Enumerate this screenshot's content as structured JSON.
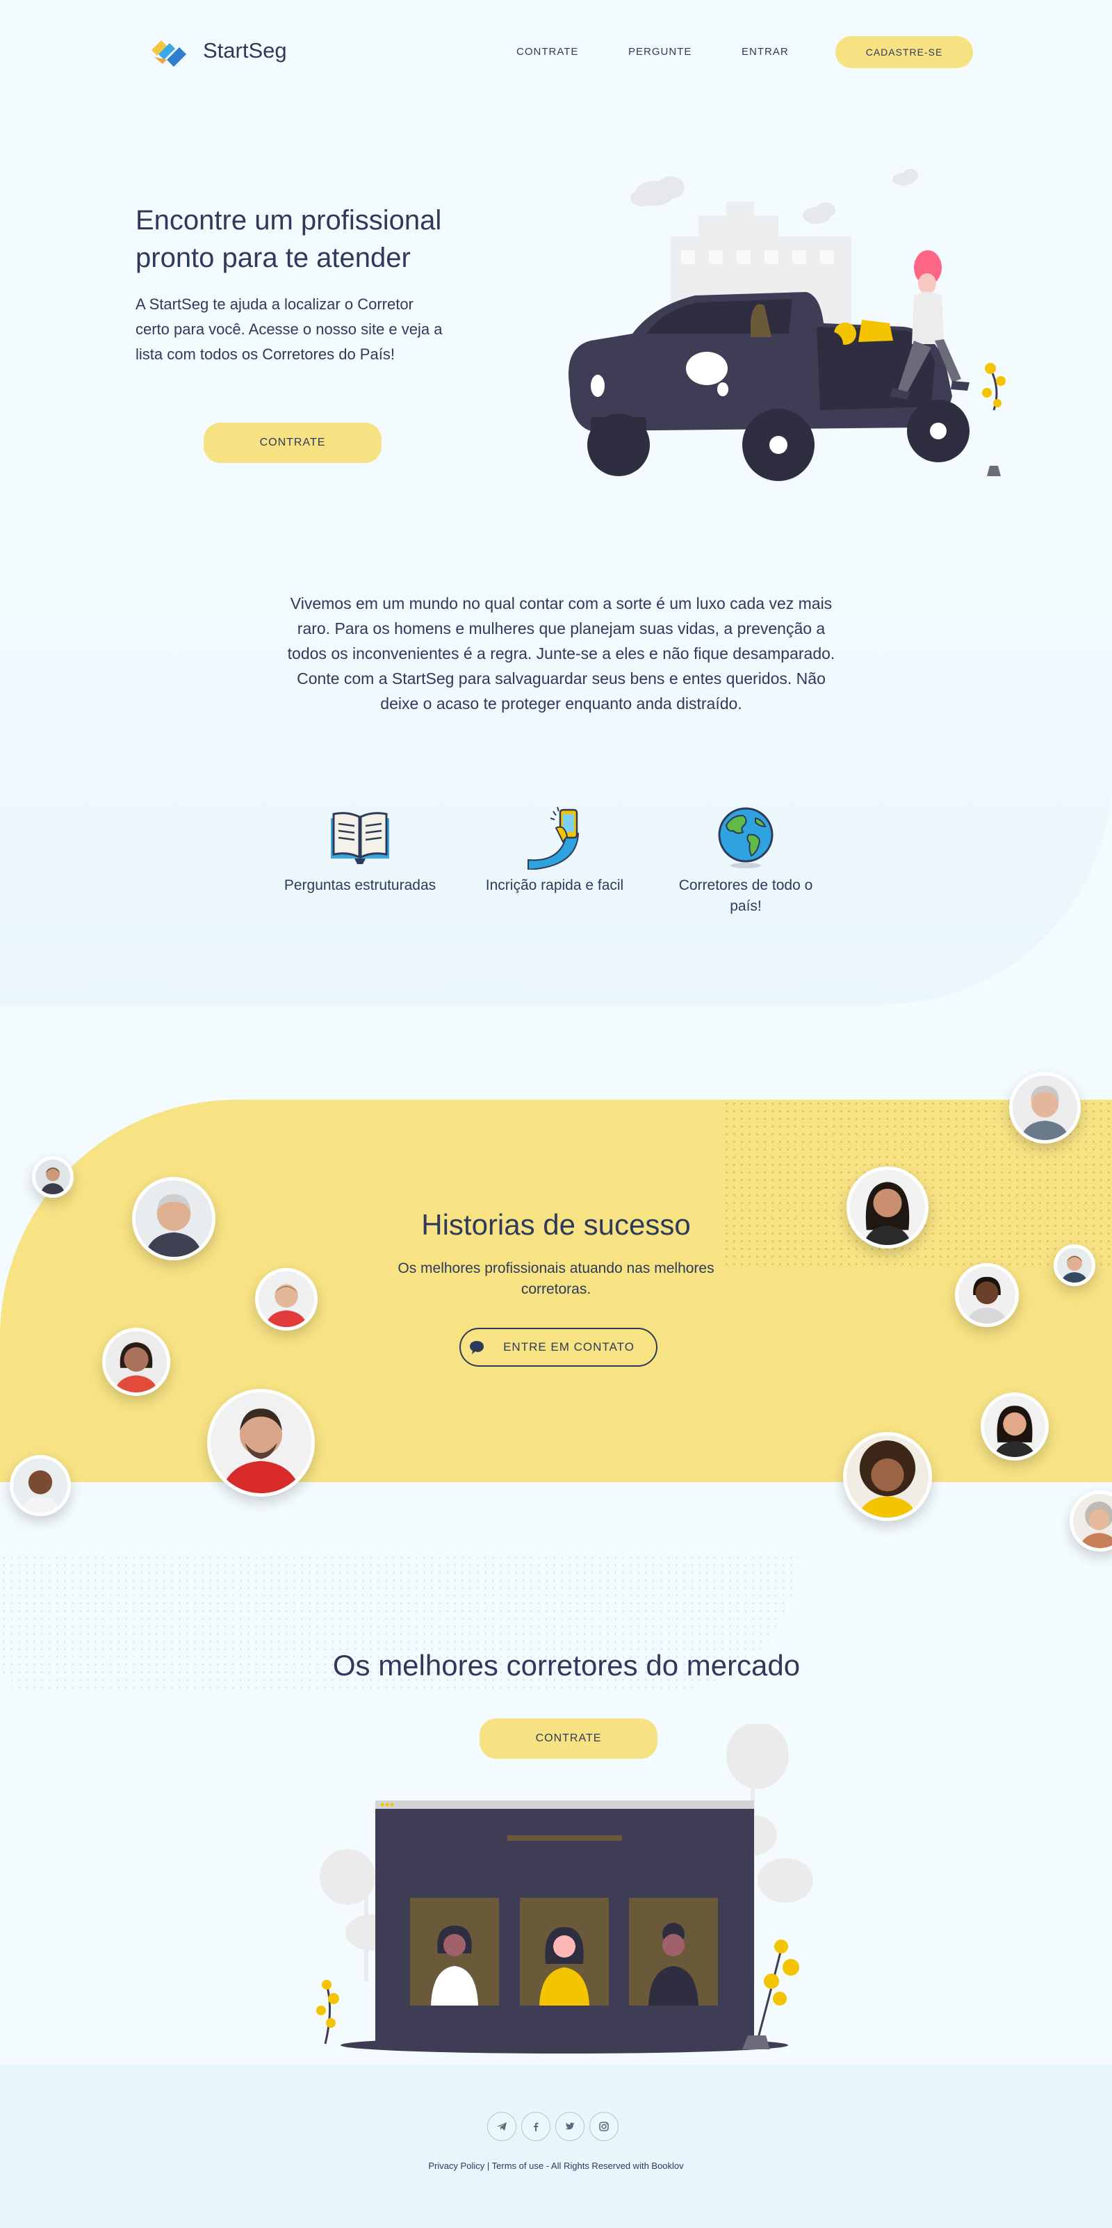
{
  "header": {
    "brand": "StartSeg",
    "nav": [
      "CONTRATE",
      "PERGUNTE",
      "ENTRAR"
    ],
    "signup_label": "CADASTRE-SE"
  },
  "hero": {
    "title": "Encontre um profissional pronto para te atender",
    "text": "A StartSeg te ajuda a localizar o Corretor certo para você. Acesse o nosso site e veja a lista com todos os Corretores do País!",
    "button_label": "CONTRATE"
  },
  "intro": {
    "text": "Vivemos em um mundo no qual contar com a sorte é um luxo cada vez mais raro. Para os homens e mulheres que planejam suas vidas, a prevenção a todos os inconvenientes é a regra. Junte-se a eles e não fique desamparado. Conte com a StartSeg para salvaguardar seus bens e entes queridos. Não deixe o acaso te proteger enquanto anda distraído."
  },
  "features": [
    {
      "label": "Perguntas estruturadas",
      "icon": "book-icon"
    },
    {
      "label": "Incrição rapida e facil",
      "icon": "phone-hand-icon"
    },
    {
      "label": "Corretores de todo o país!",
      "icon": "globe-icon"
    }
  ],
  "success": {
    "title": "Historias de sucesso",
    "subtitle": "Os melhores profissionais atuando nas melhores corretoras.",
    "button_label": "ENTRE EM CONTATO"
  },
  "brokers": {
    "title": "Os melhores corretores do mercado",
    "button_label": "CONTRATE"
  },
  "footer": {
    "socials": [
      "telegram-icon",
      "facebook-icon",
      "twitter-icon",
      "instagram-icon"
    ],
    "privacy": "Privacy Policy",
    "separator": "|",
    "terms": "Terms of use",
    "rights": "- All Rights Reserved with Booklov"
  },
  "colors": {
    "accent_yellow": "#f7e283",
    "text_dark": "#2e3a59",
    "background": "#f4fbff",
    "footer_bg": "#e6f6fc"
  }
}
